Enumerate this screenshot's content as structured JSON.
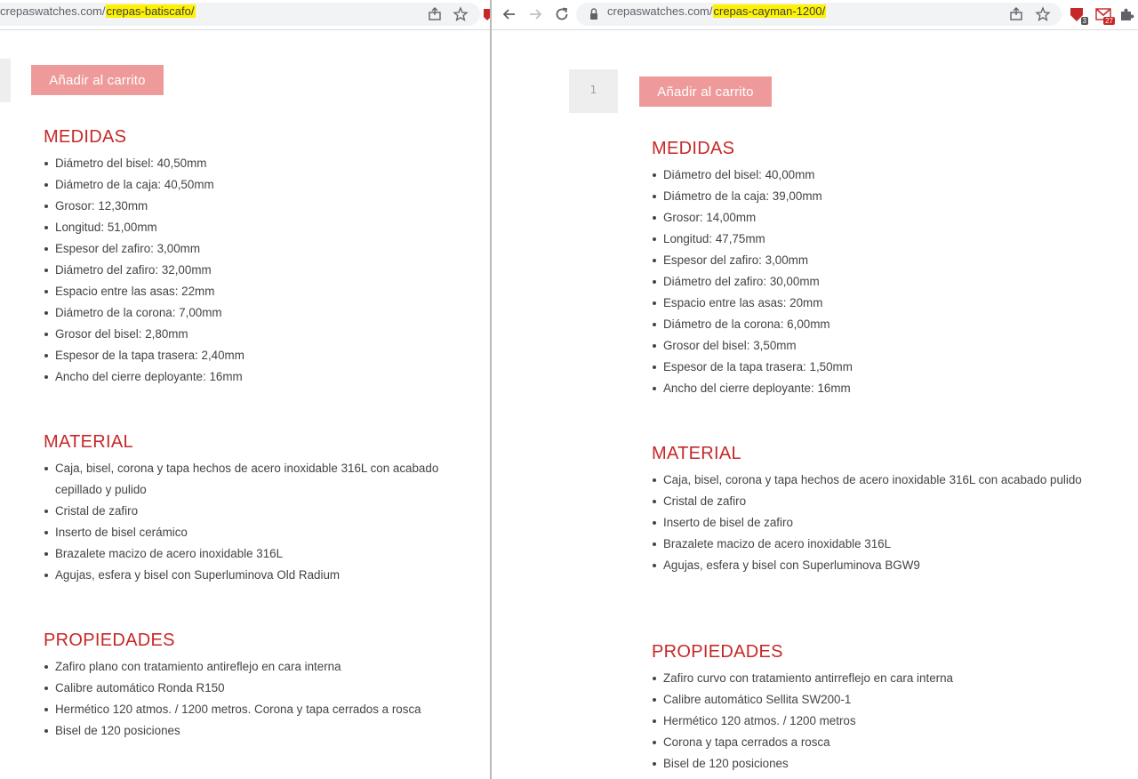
{
  "left": {
    "url_prefix": "crepaswatches.com/",
    "url_highlight": "crepas-batiscafo/",
    "add_to_cart": "Añadir al carrito",
    "sections": [
      {
        "title": "MEDIDAS",
        "items": [
          "Diámetro del bisel: 40,50mm",
          "Diámetro de la caja: 40,50mm",
          "Grosor: 12,30mm",
          "Longitud: 51,00mm",
          "Espesor del zafiro: 3,00mm",
          "Diámetro del zafiro: 32,00mm",
          "Espacio entre las asas: 22mm",
          "Diámetro de la corona: 7,00mm",
          "Grosor del bisel: 2,80mm",
          "Espesor de la tapa trasera: 2,40mm",
          "Ancho del cierre deployante: 16mm"
        ]
      },
      {
        "title": "MATERIAL",
        "items": [
          "Caja, bisel, corona y tapa hechos de acero inoxidable 316L con acabado cepillado y pulido",
          "Cristal de zafiro",
          "Inserto de bisel cerámico",
          "Brazalete macizo de acero inoxidable 316L",
          "Agujas, esfera y bisel con Superluminova Old Radium"
        ]
      },
      {
        "title": "PROPIEDADES",
        "items": [
          "Zafiro plano con tratamiento antireflejo en cara interna",
          "Calibre automático Ronda R150",
          "Hermético 120 atmos. / 1200 metros. Corona y tapa cerrados a rosca",
          "Bisel de 120 posiciones"
        ]
      }
    ]
  },
  "right": {
    "url_prefix": "crepaswatches.com/",
    "url_highlight": "crepas-cayman-1200/",
    "quantity": "1",
    "add_to_cart": "Añadir al carrito",
    "ext_badge_1": "3",
    "ext_badge_2": "27",
    "sections": [
      {
        "title": "MEDIDAS",
        "items": [
          "Diámetro del bisel: 40,00mm",
          "Diámetro de la caja: 39,00mm",
          "Grosor: 14,00mm",
          "Longitud: 47,75mm",
          "Espesor del zafiro: 3,00mm",
          "Diámetro del zafiro: 30,00mm",
          "Espacio entre las asas: 20mm",
          "Diámetro de la corona: 6,00mm",
          "Grosor del bisel: 3,50mm",
          "Espesor de la tapa trasera: 1,50mm",
          "Ancho del cierre deployante: 16mm"
        ]
      },
      {
        "title": "MATERIAL",
        "items": [
          "Caja, bisel, corona y tapa hechos de acero inoxidable 316L con acabado pulido",
          "Cristal de zafiro",
          "Inserto de bisel de zafiro",
          "Brazalete macizo de acero inoxidable 316L",
          "Agujas, esfera y bisel con Superluminova BGW9"
        ]
      },
      {
        "title": "PROPIEDADES",
        "items": [
          "Zafiro curvo con tratamiento antirreflejo en cara interna",
          "Calibre automático Sellita SW200-1",
          "Hermético 120 atmos. / 1200 metros",
          "Corona y tapa cerrados a rosca",
          "Bisel de 120 posiciones"
        ]
      }
    ]
  },
  "colors": {
    "heading": "#c62828",
    "button": "#ef9a9a",
    "highlight": "#fff200"
  }
}
